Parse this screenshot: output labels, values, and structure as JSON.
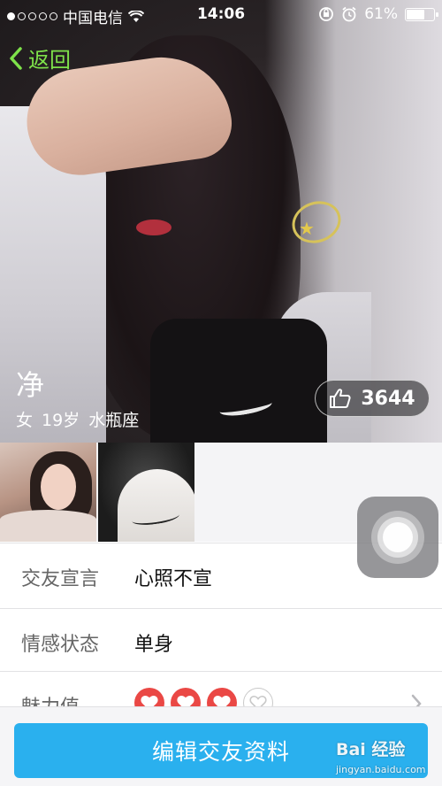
{
  "status_bar": {
    "carrier": "中国电信",
    "time": "14:06",
    "battery": "61%",
    "battery_level": 0.61,
    "signal_dots_filled": 1,
    "signal_dots_total": 5
  },
  "nav": {
    "back_label": "返回",
    "back_color": "#7ee24a"
  },
  "profile": {
    "name": "净",
    "gender": "女",
    "age": "19岁",
    "zodiac": "水瓶座",
    "likes": "3644"
  },
  "gallery": {
    "thumbnails": [
      "photo-1",
      "photo-2"
    ]
  },
  "info": {
    "declaration_label": "交友宣言",
    "declaration_value": "心照不宣",
    "relationship_label": "情感状态",
    "relationship_value": "单身",
    "charm_label": "魅力值",
    "charm_filled": 3,
    "charm_total": 4,
    "heart_color": "#ea4845"
  },
  "actions": {
    "edit_label": "编辑交友资料",
    "edit_color": "#2ab0ee"
  },
  "watermark": {
    "brand": "Bai 经验",
    "url": "jingyan.baidu.com"
  }
}
